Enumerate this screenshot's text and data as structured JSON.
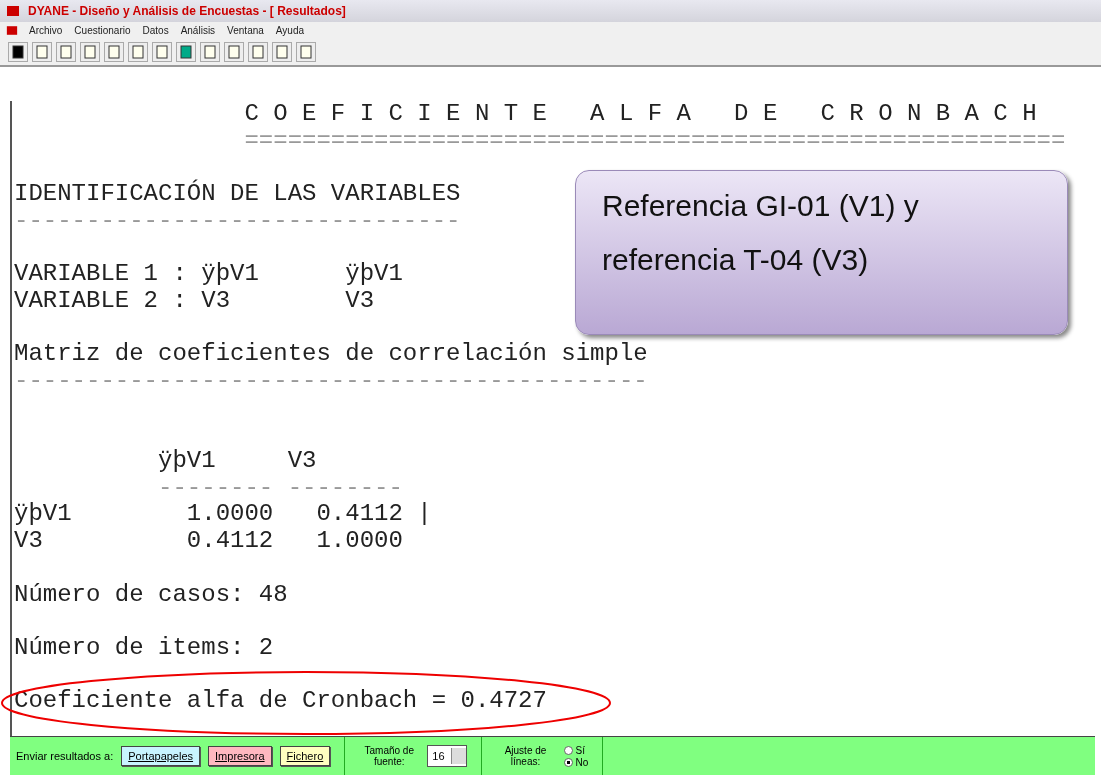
{
  "window": {
    "title": "DYANE - Diseño y Análisis de Encuestas - [ Resultados]"
  },
  "menu": [
    "Archivo",
    "Cuestionario",
    "Datos",
    "Análisis",
    "Ventana",
    "Ayuda"
  ],
  "report": {
    "sections": [
      [
        {
          "kind": "text",
          "text": "                C O E F I C I E N T E   A L F A   D E   C R O N B A C H"
        },
        {
          "kind": "rule",
          "text": "                ========================================================="
        }
      ],
      [
        {
          "kind": "text",
          "text": "IDENTIFICACIÓN DE LAS VARIABLES"
        },
        {
          "kind": "rule",
          "text": "-------------------------------"
        }
      ],
      [
        {
          "kind": "text",
          "text": "VARIABLE 1 : ÿþV1      ÿþV1"
        },
        {
          "kind": "text",
          "text": "VARIABLE 2 : V3        V3"
        }
      ],
      [
        {
          "kind": "text",
          "text": "Matriz de coeficientes de correlación simple"
        },
        {
          "kind": "rule",
          "text": "--------------------------------------------"
        }
      ],
      [
        {
          "kind": "text",
          "text": "          ÿþV1     V3"
        },
        {
          "kind": "rule",
          "text": "          -------- --------"
        },
        {
          "kind": "text",
          "text": "ÿþV1        1.0000   0.4112 |"
        },
        {
          "kind": "text",
          "text": "V3          0.4112   1.0000"
        }
      ],
      [
        {
          "kind": "text",
          "text": "Número de casos: 48"
        }
      ],
      [
        {
          "kind": "text",
          "text": "Número de items: 2"
        }
      ],
      [
        {
          "kind": "text",
          "text": "Coeficiente alfa de Cronbach = 0.4727"
        }
      ]
    ]
  },
  "callout": {
    "lines": [
      "Referencia GI-01 (V1) y",
      "referencia T-04 (V3)"
    ]
  },
  "bottom_bar": {
    "label": "Enviar resultados a:",
    "buttons": [
      {
        "label": "Portapapeles",
        "color": "#c8f4ff"
      },
      {
        "label": "Impresora",
        "color": "#ffb8c0"
      },
      {
        "label": "Fichero",
        "color": "#ffffc0"
      }
    ],
    "font_size": {
      "label": "Tamaño de fuente:",
      "value": "16"
    },
    "wrap": {
      "label": "Ajuste de líneas:",
      "options": [
        {
          "label": "Sí",
          "selected": false
        },
        {
          "label": "No",
          "selected": true
        }
      ]
    }
  }
}
